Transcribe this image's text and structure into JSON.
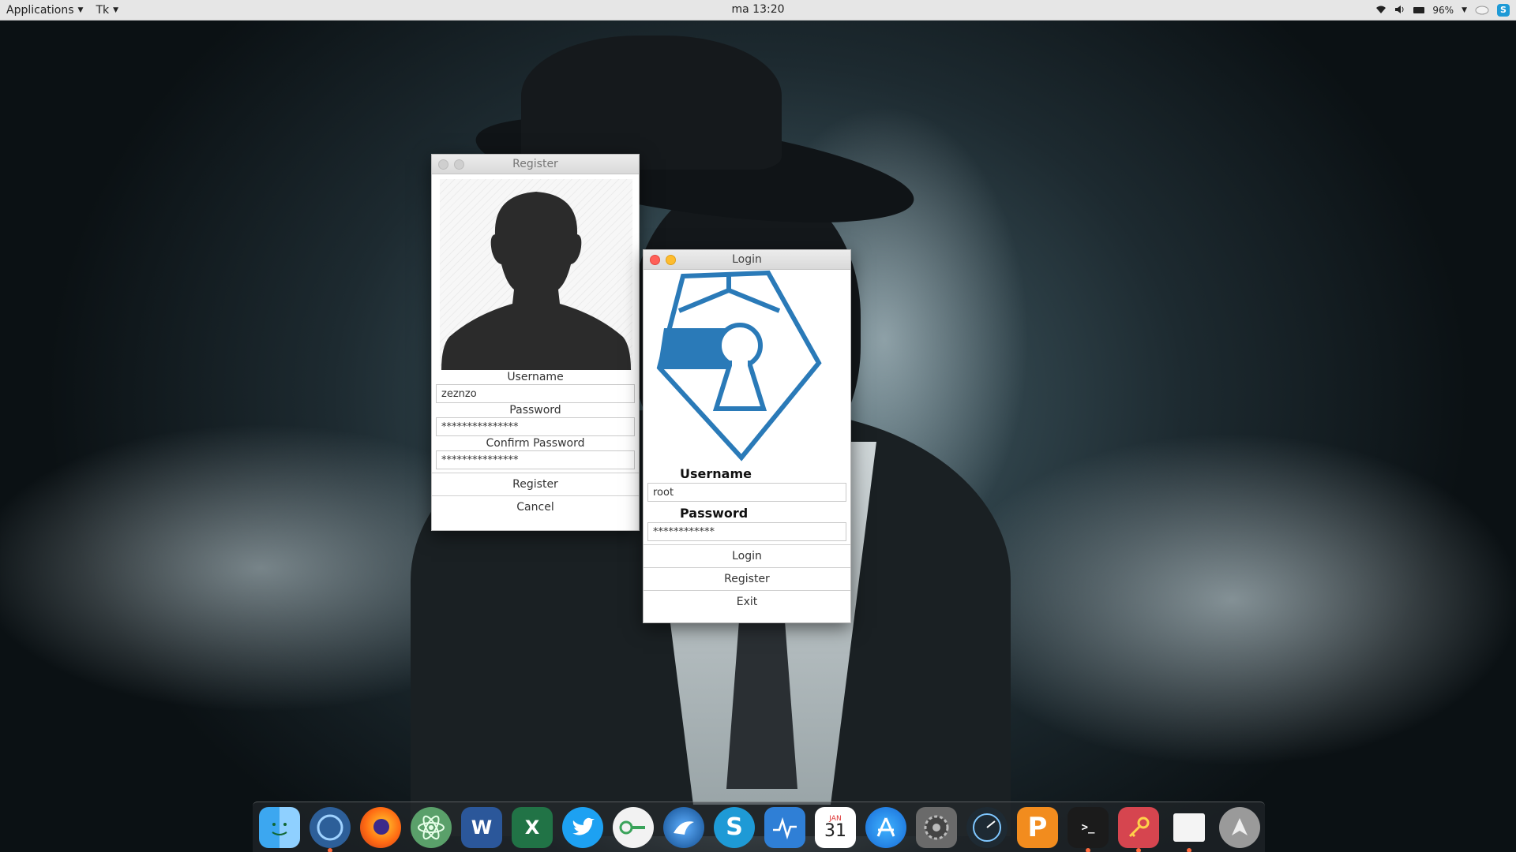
{
  "top_panel": {
    "menus": [
      {
        "label": "Applications"
      },
      {
        "label": "Tk"
      }
    ],
    "clock": "ma 13:20",
    "battery_text": "96%"
  },
  "register_window": {
    "title": "Register",
    "username_label": "Username",
    "username_value": "zeznzo",
    "password_label": "Password",
    "password_value": "***************",
    "confirm_label": "Confirm Password",
    "confirm_value": "***************",
    "register_button": "Register",
    "cancel_button": "Cancel"
  },
  "login_window": {
    "title": "Login",
    "username_label": "Username",
    "username_value": "root",
    "password_label": "Password",
    "password_value": "************",
    "login_button": "Login",
    "register_button": "Register",
    "exit_button": "Exit",
    "logo_color": "#2a7ab8"
  },
  "dock": {
    "calendar_month": "JAN",
    "calendar_day": "31",
    "items": [
      "finder-icon",
      "browser-icon",
      "firefox-icon",
      "atom-icon",
      "word-icon",
      "excel-icon",
      "twitter-icon",
      "keys-icon",
      "eagle-icon",
      "skype-icon",
      "activity-monitor-icon",
      "calendar-icon",
      "app-store-icon",
      "system-preferences-icon",
      "speed-gauge-icon",
      "pages-icon",
      "terminal-icon",
      "keychain-icon",
      "blank-app-icon",
      "launcher-icon"
    ]
  }
}
